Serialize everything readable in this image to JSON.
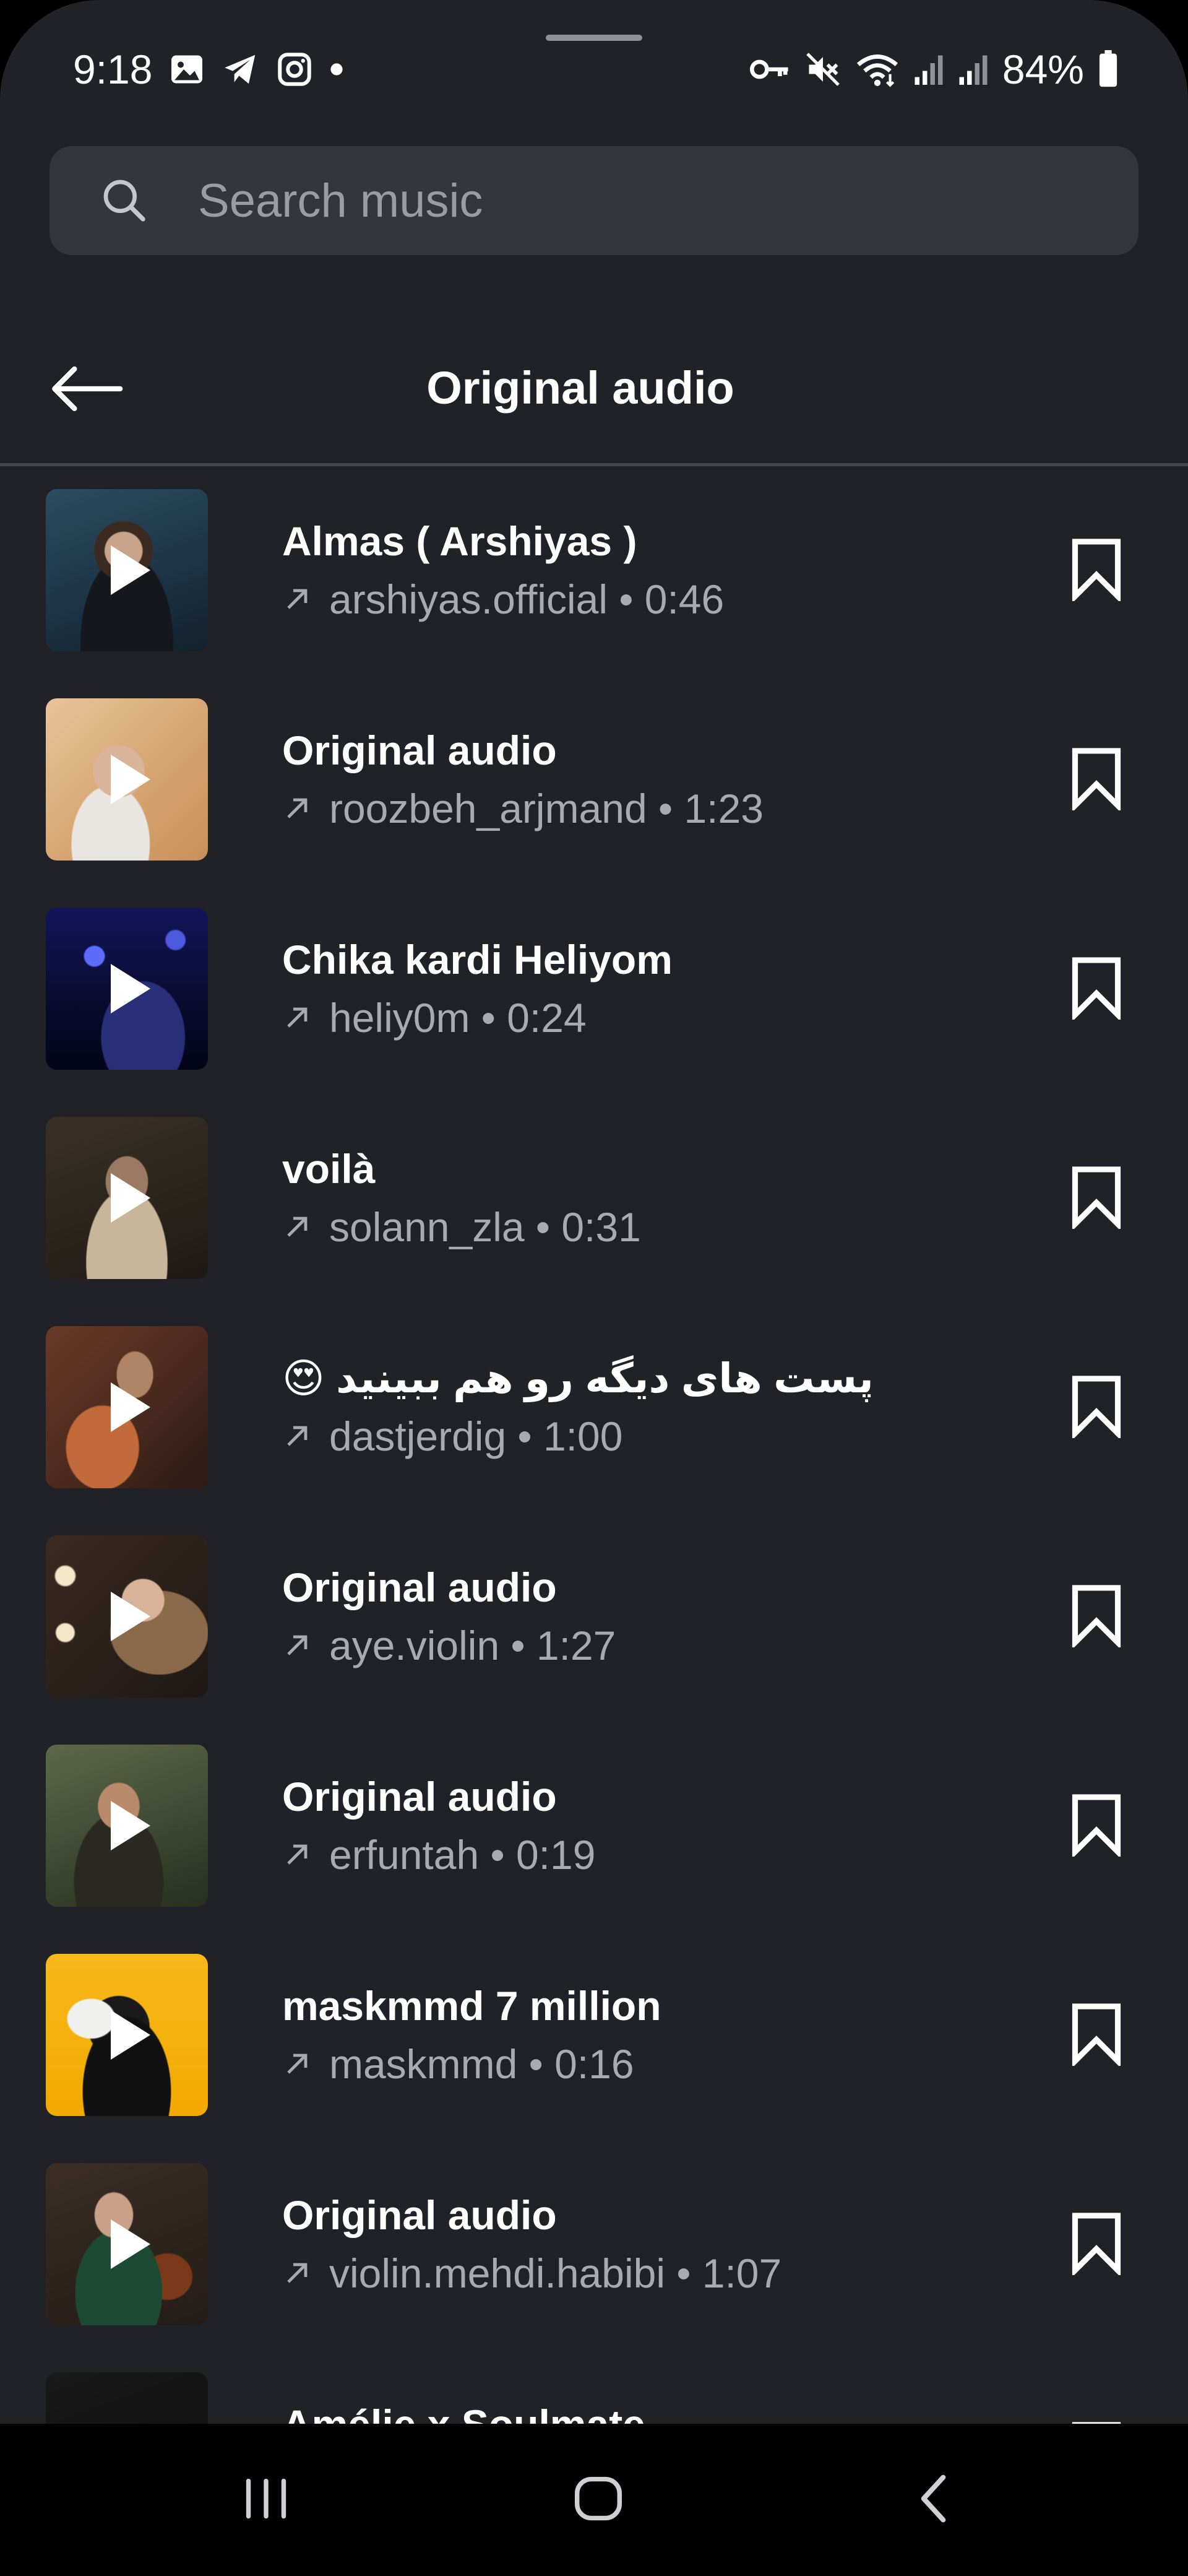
{
  "status_bar": {
    "time": "9:18",
    "battery_percent": "84%",
    "left_icons": [
      "gallery-icon",
      "telegram-icon",
      "instagram-icon",
      "dot-icon"
    ],
    "right_icons": [
      "key-icon",
      "mute-icon",
      "wifi-icon",
      "signal-icon",
      "signal-icon",
      "battery-icon"
    ]
  },
  "search": {
    "placeholder": "Search music",
    "value": ""
  },
  "header": {
    "title": "Original audio",
    "back_icon": "arrow-left-icon"
  },
  "tracks": [
    {
      "title": "Almas ( Arshiyas )",
      "artist": "arshiyas.official",
      "duration": "0:46",
      "meta": "arshiyas.official • 0:46"
    },
    {
      "title": "Original audio",
      "artist": "roozbeh_arjmand",
      "duration": "1:23",
      "meta": "roozbeh_arjmand • 1:23"
    },
    {
      "title": "Chika kardi Heliyom",
      "artist": "heliy0m",
      "duration": "0:24",
      "meta": "heliy0m • 0:24"
    },
    {
      "title": "voilà",
      "artist": "solann_zla",
      "duration": "0:31",
      "meta": "solann_zla • 0:31"
    },
    {
      "title": "پست های دیگه رو هم ببینید 😍",
      "artist": "dastjerdig",
      "duration": "1:00",
      "meta": "dastjerdig • 1:00"
    },
    {
      "title": "Original audio",
      "artist": "aye.violin",
      "duration": "1:27",
      "meta": "aye.violin • 1:27"
    },
    {
      "title": "Original audio",
      "artist": "erfuntah",
      "duration": "0:19",
      "meta": "erfuntah • 0:19"
    },
    {
      "title": "maskmmd 7 million",
      "artist": "maskmmd",
      "duration": "0:16",
      "meta": "maskmmd • 0:16"
    },
    {
      "title": "Original audio",
      "artist": "violin.mehdi.habibi",
      "duration": "1:07",
      "meta": "violin.mehdi.habibi • 1:07"
    },
    {
      "title": "Amélie x Soulmate",
      "artist": "",
      "duration": "",
      "meta": ""
    }
  ],
  "colors": {
    "background": "#212227",
    "search_bg": "#34363c",
    "text_primary": "#ffffff",
    "text_secondary": "#a9aaaf",
    "nav_bg": "#000000"
  },
  "nav_bar": {
    "icons": [
      "recent-apps-icon",
      "home-icon",
      "back-icon"
    ]
  }
}
